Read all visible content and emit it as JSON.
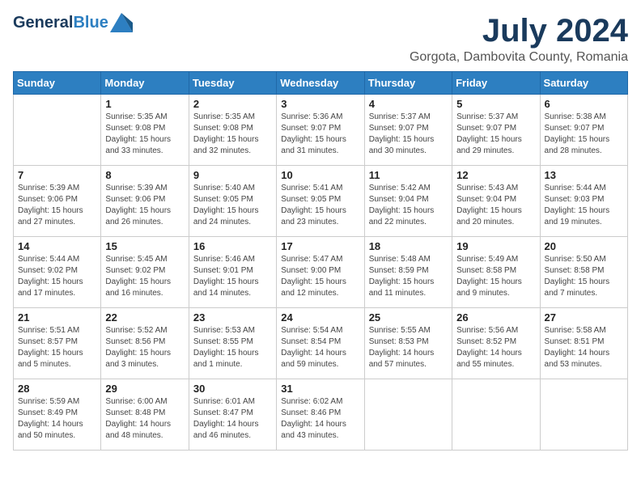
{
  "logo": {
    "general": "General",
    "blue": "Blue"
  },
  "title": "July 2024",
  "location": "Gorgota, Dambovita County, Romania",
  "days_header": [
    "Sunday",
    "Monday",
    "Tuesday",
    "Wednesday",
    "Thursday",
    "Friday",
    "Saturday"
  ],
  "weeks": [
    [
      {
        "day": "",
        "sunrise": "",
        "sunset": "",
        "daylight": ""
      },
      {
        "day": "1",
        "sunrise": "Sunrise: 5:35 AM",
        "sunset": "Sunset: 9:08 PM",
        "daylight": "Daylight: 15 hours and 33 minutes."
      },
      {
        "day": "2",
        "sunrise": "Sunrise: 5:35 AM",
        "sunset": "Sunset: 9:08 PM",
        "daylight": "Daylight: 15 hours and 32 minutes."
      },
      {
        "day": "3",
        "sunrise": "Sunrise: 5:36 AM",
        "sunset": "Sunset: 9:07 PM",
        "daylight": "Daylight: 15 hours and 31 minutes."
      },
      {
        "day": "4",
        "sunrise": "Sunrise: 5:37 AM",
        "sunset": "Sunset: 9:07 PM",
        "daylight": "Daylight: 15 hours and 30 minutes."
      },
      {
        "day": "5",
        "sunrise": "Sunrise: 5:37 AM",
        "sunset": "Sunset: 9:07 PM",
        "daylight": "Daylight: 15 hours and 29 minutes."
      },
      {
        "day": "6",
        "sunrise": "Sunrise: 5:38 AM",
        "sunset": "Sunset: 9:07 PM",
        "daylight": "Daylight: 15 hours and 28 minutes."
      }
    ],
    [
      {
        "day": "7",
        "sunrise": "Sunrise: 5:39 AM",
        "sunset": "Sunset: 9:06 PM",
        "daylight": "Daylight: 15 hours and 27 minutes."
      },
      {
        "day": "8",
        "sunrise": "Sunrise: 5:39 AM",
        "sunset": "Sunset: 9:06 PM",
        "daylight": "Daylight: 15 hours and 26 minutes."
      },
      {
        "day": "9",
        "sunrise": "Sunrise: 5:40 AM",
        "sunset": "Sunset: 9:05 PM",
        "daylight": "Daylight: 15 hours and 24 minutes."
      },
      {
        "day": "10",
        "sunrise": "Sunrise: 5:41 AM",
        "sunset": "Sunset: 9:05 PM",
        "daylight": "Daylight: 15 hours and 23 minutes."
      },
      {
        "day": "11",
        "sunrise": "Sunrise: 5:42 AM",
        "sunset": "Sunset: 9:04 PM",
        "daylight": "Daylight: 15 hours and 22 minutes."
      },
      {
        "day": "12",
        "sunrise": "Sunrise: 5:43 AM",
        "sunset": "Sunset: 9:04 PM",
        "daylight": "Daylight: 15 hours and 20 minutes."
      },
      {
        "day": "13",
        "sunrise": "Sunrise: 5:44 AM",
        "sunset": "Sunset: 9:03 PM",
        "daylight": "Daylight: 15 hours and 19 minutes."
      }
    ],
    [
      {
        "day": "14",
        "sunrise": "Sunrise: 5:44 AM",
        "sunset": "Sunset: 9:02 PM",
        "daylight": "Daylight: 15 hours and 17 minutes."
      },
      {
        "day": "15",
        "sunrise": "Sunrise: 5:45 AM",
        "sunset": "Sunset: 9:02 PM",
        "daylight": "Daylight: 15 hours and 16 minutes."
      },
      {
        "day": "16",
        "sunrise": "Sunrise: 5:46 AM",
        "sunset": "Sunset: 9:01 PM",
        "daylight": "Daylight: 15 hours and 14 minutes."
      },
      {
        "day": "17",
        "sunrise": "Sunrise: 5:47 AM",
        "sunset": "Sunset: 9:00 PM",
        "daylight": "Daylight: 15 hours and 12 minutes."
      },
      {
        "day": "18",
        "sunrise": "Sunrise: 5:48 AM",
        "sunset": "Sunset: 8:59 PM",
        "daylight": "Daylight: 15 hours and 11 minutes."
      },
      {
        "day": "19",
        "sunrise": "Sunrise: 5:49 AM",
        "sunset": "Sunset: 8:58 PM",
        "daylight": "Daylight: 15 hours and 9 minutes."
      },
      {
        "day": "20",
        "sunrise": "Sunrise: 5:50 AM",
        "sunset": "Sunset: 8:58 PM",
        "daylight": "Daylight: 15 hours and 7 minutes."
      }
    ],
    [
      {
        "day": "21",
        "sunrise": "Sunrise: 5:51 AM",
        "sunset": "Sunset: 8:57 PM",
        "daylight": "Daylight: 15 hours and 5 minutes."
      },
      {
        "day": "22",
        "sunrise": "Sunrise: 5:52 AM",
        "sunset": "Sunset: 8:56 PM",
        "daylight": "Daylight: 15 hours and 3 minutes."
      },
      {
        "day": "23",
        "sunrise": "Sunrise: 5:53 AM",
        "sunset": "Sunset: 8:55 PM",
        "daylight": "Daylight: 15 hours and 1 minute."
      },
      {
        "day": "24",
        "sunrise": "Sunrise: 5:54 AM",
        "sunset": "Sunset: 8:54 PM",
        "daylight": "Daylight: 14 hours and 59 minutes."
      },
      {
        "day": "25",
        "sunrise": "Sunrise: 5:55 AM",
        "sunset": "Sunset: 8:53 PM",
        "daylight": "Daylight: 14 hours and 57 minutes."
      },
      {
        "day": "26",
        "sunrise": "Sunrise: 5:56 AM",
        "sunset": "Sunset: 8:52 PM",
        "daylight": "Daylight: 14 hours and 55 minutes."
      },
      {
        "day": "27",
        "sunrise": "Sunrise: 5:58 AM",
        "sunset": "Sunset: 8:51 PM",
        "daylight": "Daylight: 14 hours and 53 minutes."
      }
    ],
    [
      {
        "day": "28",
        "sunrise": "Sunrise: 5:59 AM",
        "sunset": "Sunset: 8:49 PM",
        "daylight": "Daylight: 14 hours and 50 minutes."
      },
      {
        "day": "29",
        "sunrise": "Sunrise: 6:00 AM",
        "sunset": "Sunset: 8:48 PM",
        "daylight": "Daylight: 14 hours and 48 minutes."
      },
      {
        "day": "30",
        "sunrise": "Sunrise: 6:01 AM",
        "sunset": "Sunset: 8:47 PM",
        "daylight": "Daylight: 14 hours and 46 minutes."
      },
      {
        "day": "31",
        "sunrise": "Sunrise: 6:02 AM",
        "sunset": "Sunset: 8:46 PM",
        "daylight": "Daylight: 14 hours and 43 minutes."
      },
      {
        "day": "",
        "sunrise": "",
        "sunset": "",
        "daylight": ""
      },
      {
        "day": "",
        "sunrise": "",
        "sunset": "",
        "daylight": ""
      },
      {
        "day": "",
        "sunrise": "",
        "sunset": "",
        "daylight": ""
      }
    ]
  ]
}
